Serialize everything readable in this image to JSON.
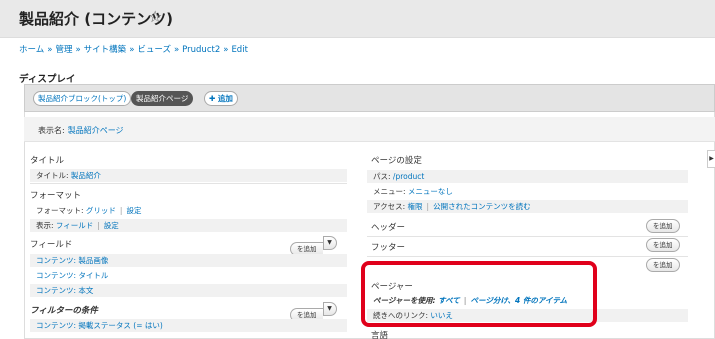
{
  "header": {
    "title": "製品紹介 (コンテンツ)",
    "star": "☆"
  },
  "breadcrumb": {
    "items": [
      "ホーム",
      "管理",
      "サイト構築",
      "ビューズ",
      "Pruduct2",
      "Edit"
    ],
    "separator": "»"
  },
  "display_section_label": "ディスプレイ",
  "tabs": [
    {
      "label": "製品紹介ブロック(トップ)",
      "active": false
    },
    {
      "label": "製品紹介ページ",
      "active": true
    },
    {
      "label": "✚ 追加",
      "active": false
    }
  ],
  "display_name": {
    "label": "表示名:",
    "value": "製品紹介ページ"
  },
  "left": {
    "title_section": {
      "heading": "タイトル",
      "row_label": "タイトル:",
      "row_value": "製品紹介"
    },
    "format_section": {
      "heading": "フォーマット",
      "format_label": "フォーマット:",
      "format_value": "グリッド",
      "format_settings": "設定",
      "show_label": "表示:",
      "show_value": "フィールド",
      "show_settings": "設定"
    },
    "fields_section": {
      "heading": "フィールド",
      "add_label": "を追加",
      "items": [
        "コンテンツ: 製品画像",
        "コンテンツ: タイトル",
        "コンテンツ: 本文"
      ]
    },
    "filters_section": {
      "heading": "フィルターの条件",
      "add_label": "を追加",
      "items": [
        "コンテンツ: 掲載ステータス (= はい)"
      ]
    }
  },
  "right": {
    "page_settings": {
      "heading": "ページの設定",
      "path_label": "パス:",
      "path_value": "/product",
      "menu_label": "メニュー:",
      "menu_value": "メニューなし",
      "access_label": "アクセス:",
      "access_value": "権限",
      "access_detail": "公開されたコンテンツを読む"
    },
    "header_section": {
      "heading": "ヘッダー",
      "add_label": "を追加"
    },
    "footer_section": {
      "heading": "フッター",
      "add_label": "を追加"
    },
    "pager_section": {
      "heading": "ページャー",
      "use_label": "ページャーを使用:",
      "use_value": "すべて",
      "paged_value": "ページ分け、4 件のアイテム",
      "more_label": "続きへのリンク:",
      "more_value": "いいえ"
    },
    "language_section": {
      "heading": "言語"
    }
  }
}
